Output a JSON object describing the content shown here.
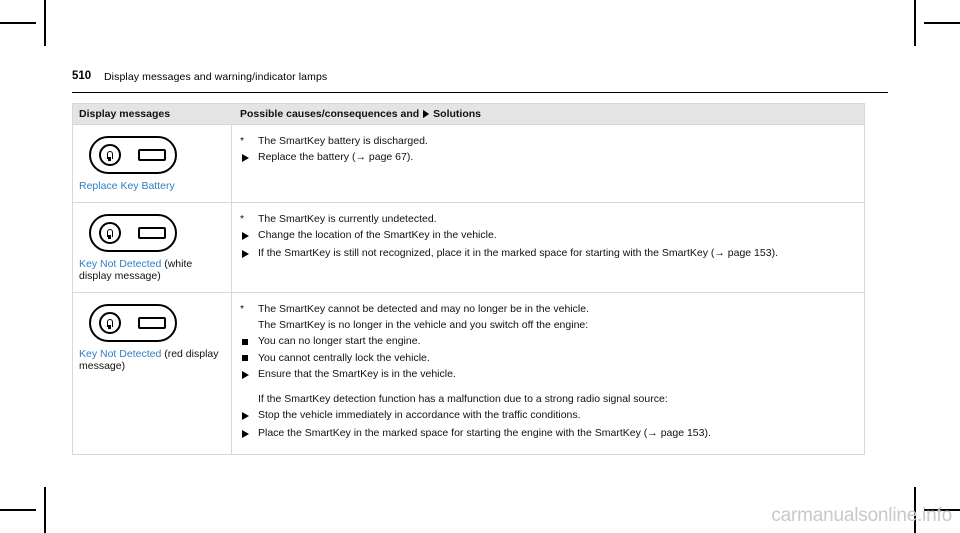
{
  "header": {
    "page_number": "510",
    "title": "Display messages and warning/indicator lamps"
  },
  "table": {
    "columns": [
      "Display messages",
      "Possible causes/consequences and",
      "Solutions"
    ],
    "rows": [
      {
        "icon": "smartkey-fob-icon",
        "message": "Replace Key Battery",
        "message_note": "",
        "content": [
          {
            "marker": "star",
            "text": "The SmartKey battery is discharged."
          },
          {
            "marker": "arrow",
            "text": "Replace the battery (→ page 67)."
          }
        ]
      },
      {
        "icon": "smartkey-fob-icon",
        "message": "Key Not Detected",
        "message_note": "(white display message)",
        "content": [
          {
            "marker": "star",
            "text": "The SmartKey is currently undetected."
          },
          {
            "marker": "arrow",
            "text": "Change the location of the SmartKey in the vehicle."
          },
          {
            "marker": "arrow",
            "text": "If the SmartKey is still not recognized, place it in the marked space for starting with the SmartKey (→ page 153)."
          }
        ]
      },
      {
        "icon": "smartkey-fob-icon",
        "message": "Key Not Detected",
        "message_note": "(red display message)",
        "content": [
          {
            "marker": "star",
            "text": "The SmartKey cannot be detected and may no longer be in the vehicle."
          },
          {
            "marker": "none",
            "text": "The SmartKey is no longer in the vehicle and you switch off the engine:"
          },
          {
            "marker": "dot",
            "text": "You can no longer start the engine."
          },
          {
            "marker": "dot",
            "text": "You cannot centrally lock the vehicle."
          },
          {
            "marker": "arrow",
            "text": "Ensure that the SmartKey is in the vehicle."
          },
          {
            "marker": "spacer",
            "text": ""
          },
          {
            "marker": "none",
            "text": "If the SmartKey detection function has a malfunction due to a strong radio signal source:"
          },
          {
            "marker": "arrow",
            "text": "Stop the vehicle immediately in accordance with the traffic conditions."
          },
          {
            "marker": "arrow",
            "text": "Place the SmartKey in the marked space for starting the engine with the SmartKey (→ page 153)."
          }
        ]
      }
    ]
  },
  "watermark": "carmanualsonline.info",
  "colors": {
    "message_link": "#2f7fc4",
    "header_band": "#e4e4e4",
    "border": "#d8d8d8"
  }
}
